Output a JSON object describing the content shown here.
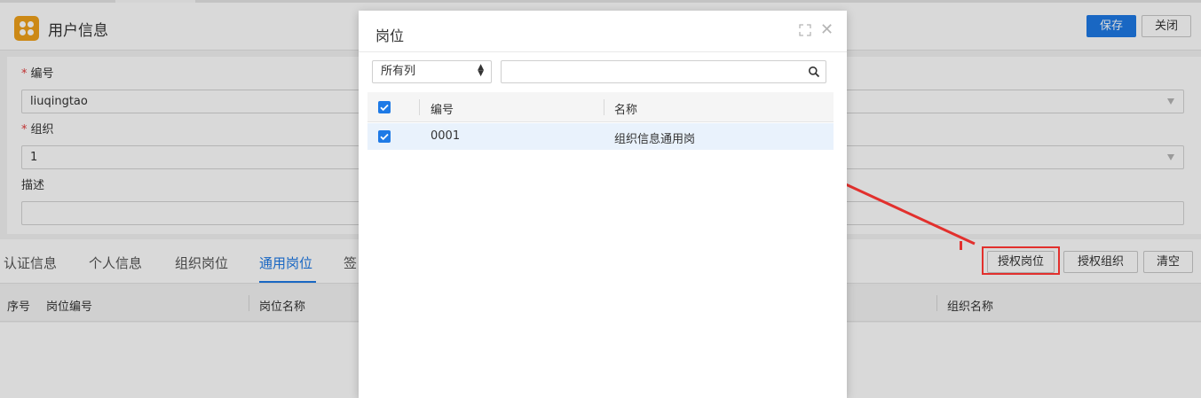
{
  "header": {
    "title": "用户信息",
    "save_label": "保存",
    "close_label": "关闭"
  },
  "form": {
    "code_label": "编号",
    "code_value": "liuqingtao",
    "org_label": "组织",
    "org_value": "1",
    "desc_label": "描述",
    "desc_value": "",
    "required_mark": "*"
  },
  "tabs": [
    {
      "label": "认证信息"
    },
    {
      "label": "个人信息"
    },
    {
      "label": "组织岗位"
    },
    {
      "label": "通用岗位",
      "active": true
    },
    {
      "label": "签"
    }
  ],
  "actions": {
    "grant_post": "授权岗位",
    "grant_org": "授权组织",
    "clear": "清空"
  },
  "grid": {
    "columns": [
      "序号",
      "岗位编号",
      "岗位名称",
      "组织名称"
    ]
  },
  "dialog": {
    "title": "岗位",
    "column_select": "所有列",
    "search_value": "",
    "columns": [
      "编号",
      "名称"
    ],
    "rows": [
      {
        "code": "0001",
        "name": "组织信息通用岗",
        "checked": true
      }
    ],
    "select_all_checked": true
  },
  "colors": {
    "primary": "#1e7ae6",
    "highlight": "#e2302d",
    "app_icon": "#f0a21a"
  }
}
